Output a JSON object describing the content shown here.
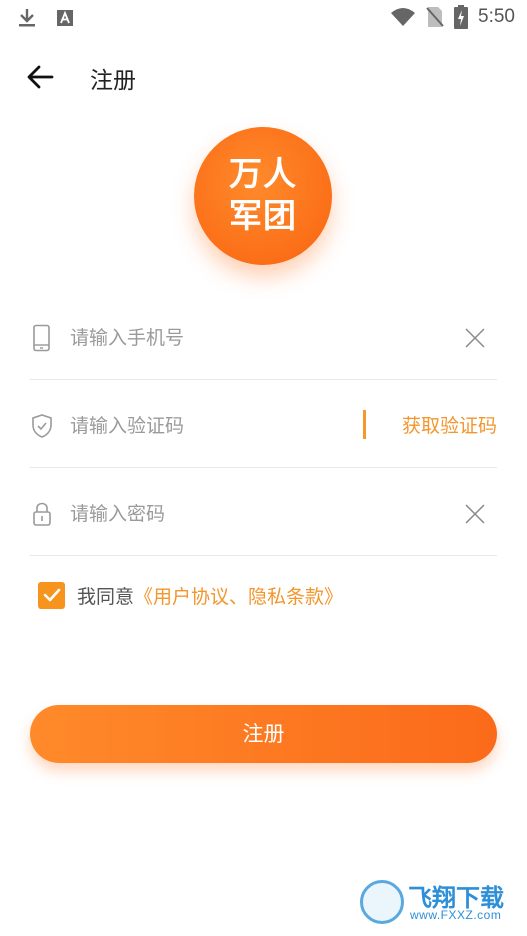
{
  "status_bar": {
    "time": "5:50",
    "icons": [
      "download-icon",
      "font-app-icon",
      "wifi-icon",
      "no-sim-icon",
      "battery-charging-icon"
    ]
  },
  "header": {
    "title": "注册",
    "back_icon": "arrow-left-icon"
  },
  "logo": {
    "line1": "万人",
    "line2": "军团",
    "color": "#fb6f18"
  },
  "form": {
    "phone": {
      "placeholder": "请输入手机号",
      "value": "",
      "icon": "phone-icon",
      "clear_icon": "close-icon"
    },
    "vcode": {
      "placeholder": "请输入验证码",
      "value": "",
      "icon": "shield-check-icon",
      "button_label": "获取验证码"
    },
    "password": {
      "placeholder": "请输入密码",
      "value": "",
      "icon": "lock-icon",
      "clear_icon": "close-icon"
    }
  },
  "agreement": {
    "checked": true,
    "prefix": "我同意",
    "link": "《用户协议、隐私条款》"
  },
  "submit": {
    "label": "注册"
  },
  "watermark": {
    "title": "飞翔下载",
    "url": "www.FXXZ.com"
  },
  "colors": {
    "accent": "#f7941d",
    "accent_dark": "#fb6a1a",
    "divider": "#e8e8e8",
    "placeholder": "#9a9a9a"
  }
}
